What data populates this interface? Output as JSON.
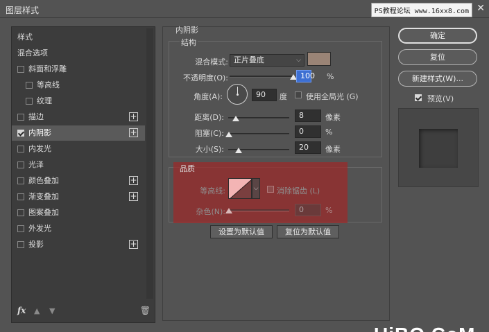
{
  "window": {
    "title": "图层样式",
    "watermark": "PS教程论坛 www.16xx8.com",
    "close_glyph": "✕"
  },
  "sidebar": {
    "items": [
      {
        "label": "样式",
        "checkbox": false,
        "checked": false,
        "plus": false,
        "indent": false,
        "active": false
      },
      {
        "label": "混合选项",
        "checkbox": false,
        "checked": false,
        "plus": false,
        "indent": false,
        "active": false
      },
      {
        "label": "斜面和浮雕",
        "checkbox": true,
        "checked": false,
        "plus": false,
        "indent": false,
        "active": false
      },
      {
        "label": "等高线",
        "checkbox": true,
        "checked": false,
        "plus": false,
        "indent": true,
        "active": false
      },
      {
        "label": "纹理",
        "checkbox": true,
        "checked": false,
        "plus": false,
        "indent": true,
        "active": false
      },
      {
        "label": "描边",
        "checkbox": true,
        "checked": false,
        "plus": true,
        "indent": false,
        "active": false
      },
      {
        "label": "内阴影",
        "checkbox": true,
        "checked": true,
        "plus": true,
        "indent": false,
        "active": true
      },
      {
        "label": "内发光",
        "checkbox": true,
        "checked": false,
        "plus": false,
        "indent": false,
        "active": false
      },
      {
        "label": "光泽",
        "checkbox": true,
        "checked": false,
        "plus": false,
        "indent": false,
        "active": false
      },
      {
        "label": "颜色叠加",
        "checkbox": true,
        "checked": false,
        "plus": true,
        "indent": false,
        "active": false
      },
      {
        "label": "渐变叠加",
        "checkbox": true,
        "checked": false,
        "plus": true,
        "indent": false,
        "active": false
      },
      {
        "label": "图案叠加",
        "checkbox": true,
        "checked": false,
        "plus": false,
        "indent": false,
        "active": false
      },
      {
        "label": "外发光",
        "checkbox": true,
        "checked": false,
        "plus": false,
        "indent": false,
        "active": false
      },
      {
        "label": "投影",
        "checkbox": true,
        "checked": false,
        "plus": true,
        "indent": false,
        "active": false
      }
    ],
    "footer": {
      "fx": "fx",
      "up_glyph": "▲",
      "down_glyph": "▼",
      "trash_glyph": "🗑"
    }
  },
  "panel": {
    "title": "内阴影",
    "structure": {
      "title": "结构",
      "blend_mode_label": "混合模式:",
      "blend_mode_value": "正片叠底",
      "shadow_color": "#9a8476",
      "opacity_label": "不透明度(O):",
      "opacity_value": "100",
      "opacity_fraction": 1.0,
      "opacity_unit": "%",
      "angle_label": "角度(A):",
      "angle_value": "90",
      "angle_unit": "度",
      "global_light_label": "使用全局光 (G)",
      "global_light_checked": false,
      "distance_label": "距离(D):",
      "distance_value": "8",
      "distance_unit": "像素",
      "choke_label": "阻塞(C):",
      "choke_value": "0",
      "choke_unit": "%",
      "size_label": "大小(S):",
      "size_value": "20",
      "size_unit": "像素"
    },
    "quality": {
      "title": "品质",
      "contour_label": "等高线:",
      "antialias_label": "消除锯齿 (L)",
      "antialias_checked": false,
      "noise_label": "杂色(N):",
      "noise_value": "0",
      "noise_unit": "%"
    },
    "buttons": {
      "set_default": "设置为默认值",
      "reset_default": "复位为默认值"
    }
  },
  "right": {
    "ok": "确定",
    "reset": "复位",
    "new_style": "新建样式(W)...",
    "preview_label": "预览(V)",
    "preview_checked": true
  },
  "brand": "UiBQ.CoM"
}
